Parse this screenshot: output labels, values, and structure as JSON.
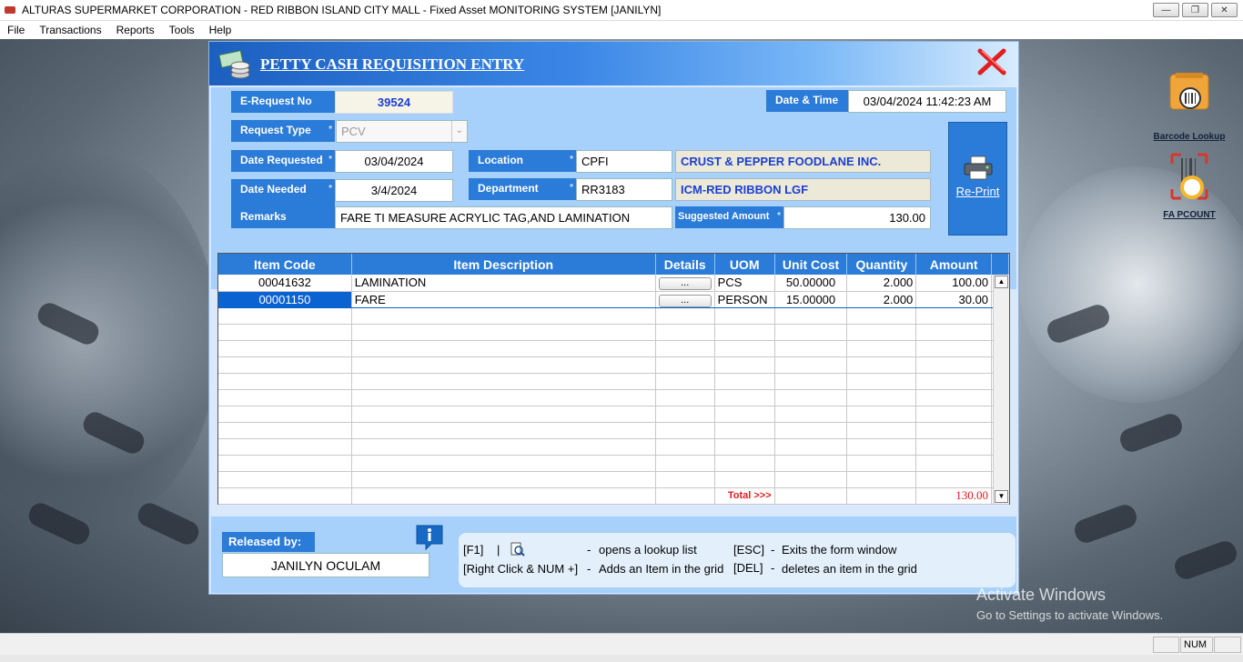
{
  "window": {
    "title": "ALTURAS SUPERMARKET CORPORATION - RED RIBBON ISLAND CITY MALL - Fixed Asset MONITORING SYSTEM [JANILYN]"
  },
  "menu": [
    "File",
    "Transactions",
    "Reports",
    "Tools",
    "Help"
  ],
  "side_icons": {
    "barcode_lookup": "Barcode Lookup",
    "fa_pcount": "FA PCOUNT"
  },
  "form": {
    "title": "PETTY CASH REQUISITION ENTRY",
    "fields": {
      "erequest_label": "E-Request No",
      "erequest_value": "39524",
      "datetime_label": "Date & Time",
      "datetime_value": "03/04/2024 11:42:23 AM",
      "request_type_label": "Request Type",
      "request_type_value": "PCV",
      "date_requested_label": "Date Requested",
      "date_requested_value": "03/04/2024",
      "date_needed_label": "Date Needed",
      "date_needed_value": "3/4/2024",
      "location_label": "Location",
      "location_value": "CPFI",
      "location_name": "CRUST & PEPPER FOODLANE INC.",
      "department_label": "Department",
      "department_value": "RR3183",
      "department_name": "ICM-RED RIBBON LGF",
      "remarks_label": "Remarks",
      "remarks_value": "FARE TI MEASURE ACRYLIC TAG,AND LAMINATION",
      "suggested_label": "Suggested Amount",
      "suggested_value": "130.00",
      "required_mark": "*"
    },
    "reprint_label": "Re-Print",
    "grid": {
      "headers": [
        "Item Code",
        "Item Description",
        "Details",
        "UOM",
        "Unit Cost",
        "Quantity",
        "Amount"
      ],
      "details_button": "...",
      "rows": [
        {
          "code": "00041632",
          "desc": "LAMINATION",
          "uom": "PCS",
          "unit_cost": "50.00000",
          "qty": "2.000",
          "amount": "100.00"
        },
        {
          "code": "00001150",
          "desc": "FARE",
          "uom": "PERSON",
          "unit_cost": "15.00000",
          "qty": "2.000",
          "amount": "30.00"
        }
      ],
      "total_label": "Total >>>",
      "total_value": "130.00"
    },
    "released_label": "Released by:",
    "released_value": "JANILYN OCULAM",
    "help": {
      "f1": "[F1]",
      "sep": "|",
      "dash": "-",
      "lookup_desc": "opens a lookup list",
      "rightclick": "[Right Click & NUM +]",
      "rightclick_desc": "Adds an Item in the grid",
      "esc": "[ESC]",
      "esc_desc": "Exits the form window",
      "del": "[DEL]",
      "del_desc": "deletes an item in the grid"
    }
  },
  "activate": {
    "line1": "Activate Windows",
    "line2": "Go to Settings to activate Windows."
  },
  "status": {
    "num": "NUM"
  }
}
